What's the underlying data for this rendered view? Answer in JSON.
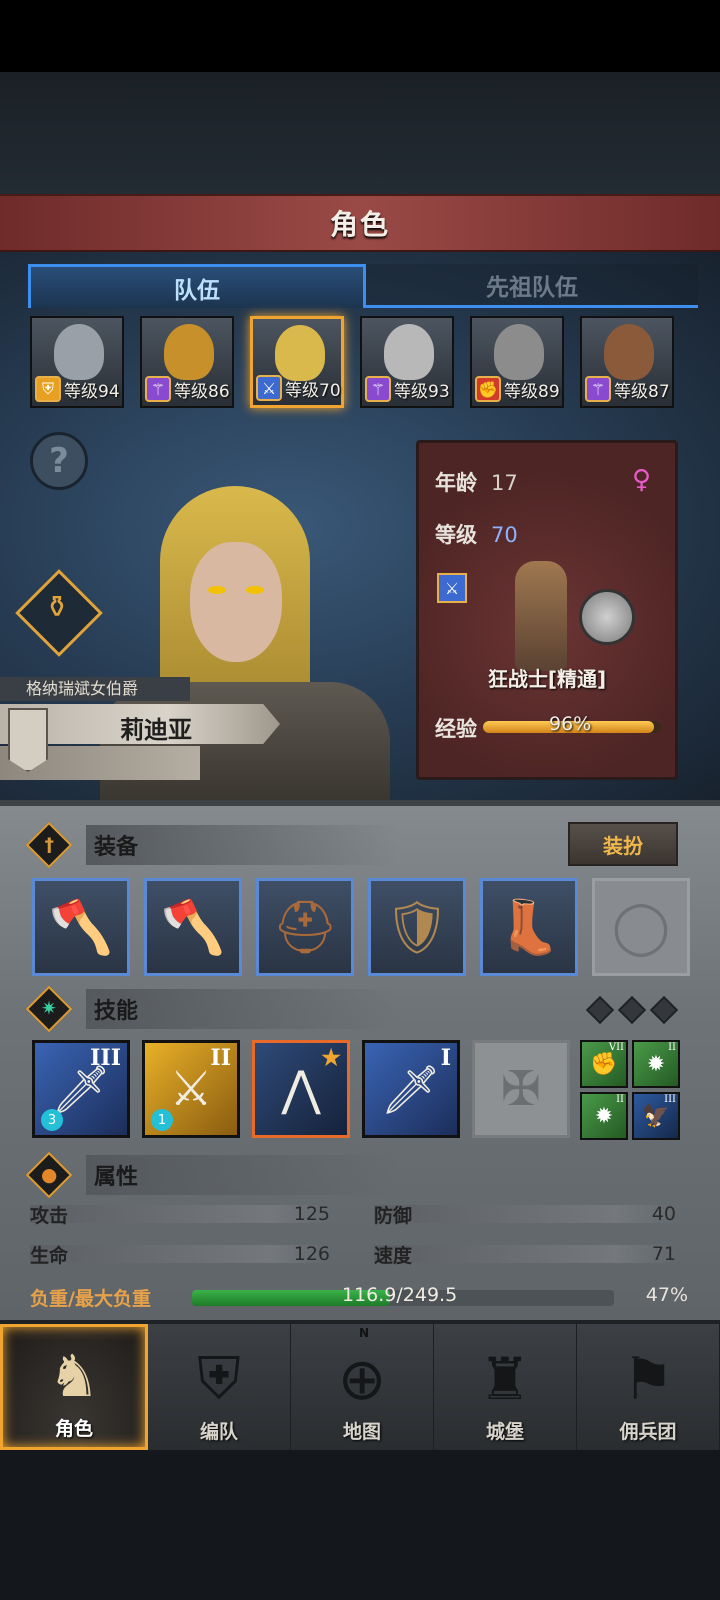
{
  "header": {
    "title": "角色"
  },
  "tabs": [
    {
      "label": "队伍",
      "active": true
    },
    {
      "label": "先祖队伍",
      "active": false
    }
  ],
  "party": [
    {
      "level_text": "等级94",
      "class_icon": "shield-icon",
      "class_color": "#e8a022"
    },
    {
      "level_text": "等级86",
      "class_icon": "staff-icon",
      "class_color": "#8a4ad0"
    },
    {
      "level_text": "等级70",
      "class_icon": "sword-icon",
      "class_color": "#3d6ad0",
      "selected": true
    },
    {
      "level_text": "等级93",
      "class_icon": "staff-icon",
      "class_color": "#8a4ad0"
    },
    {
      "level_text": "等级89",
      "class_icon": "fist-icon",
      "class_color": "#d23a2a"
    },
    {
      "level_text": "等级87",
      "class_icon": "staff-icon",
      "class_color": "#8a4ad0"
    }
  ],
  "hero": {
    "title": "格纳瑞斌女伯爵",
    "name": "莉迪亚"
  },
  "info": {
    "age_label": "年龄",
    "age": "17",
    "level_label": "等级",
    "level": "70",
    "gender_icon": "female-icon",
    "class_name": "狂战士[精通]",
    "exp_label": "经验",
    "exp_percent": "96%",
    "exp_fraction": 0.96
  },
  "equipment": {
    "label": "装备",
    "dress_button": "装扮",
    "slots": [
      "axe-icon",
      "axe-icon",
      "helmet-icon",
      "armor-icon",
      "boots-icon",
      "ring-icon-empty"
    ]
  },
  "skills": {
    "label": "技能",
    "items": [
      {
        "rank": "III",
        "count": "3",
        "icon": "sword-drop-icon"
      },
      {
        "rank": "II",
        "count": "1",
        "icon": "claw-icon"
      },
      {
        "rank": "★",
        "icon": "claw-slash-icon"
      },
      {
        "rank": "I",
        "icon": "sword-splash-icon"
      }
    ],
    "minis": [
      {
        "rank": "VII",
        "icon": "fist-mini-icon"
      },
      {
        "rank": "II",
        "icon": "burst-mini-icon"
      },
      {
        "rank": "II",
        "icon": "burst-mini-icon"
      },
      {
        "rank": "III",
        "icon": "eagle-mini-icon"
      }
    ]
  },
  "attributes": {
    "label": "属性",
    "attack_label": "攻击",
    "attack": "125",
    "defense_label": "防御",
    "defense": "40",
    "hp_label": "生命",
    "hp": "126",
    "speed_label": "速度",
    "speed": "71",
    "load_label": "负重/最大负重",
    "load_text": "116.9/249.5",
    "load_percent": "47%",
    "load_fraction": 0.47
  },
  "nav": [
    {
      "label": "角色",
      "icon": "knight-icon",
      "active": true
    },
    {
      "label": "编队",
      "icon": "formation-icon"
    },
    {
      "label": "地图",
      "icon": "compass-map-icon"
    },
    {
      "label": "城堡",
      "icon": "castle-icon"
    },
    {
      "label": "佣兵团",
      "icon": "mercenary-icon"
    }
  ]
}
